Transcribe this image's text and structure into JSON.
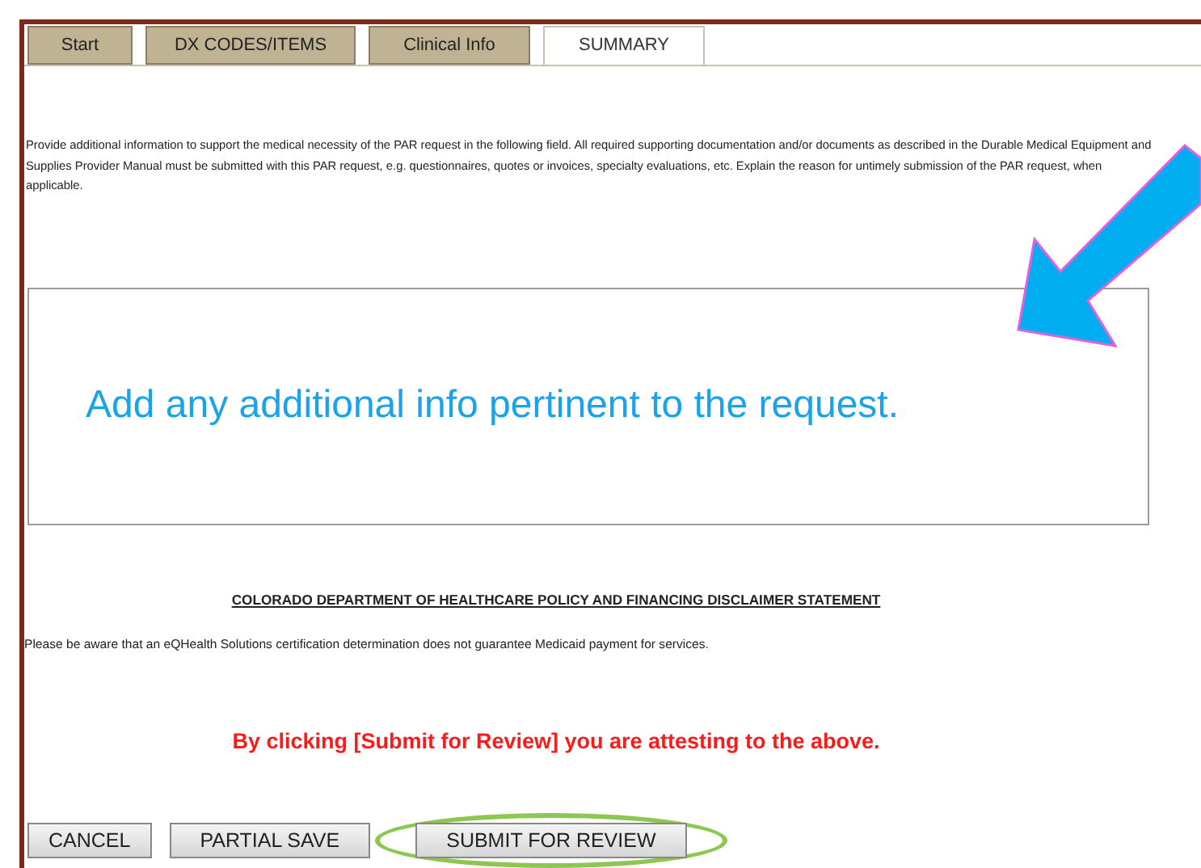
{
  "tabs": [
    {
      "label": "Start",
      "selected": false
    },
    {
      "label": "DX CODES/ITEMS",
      "selected": false
    },
    {
      "label": "Clinical Info",
      "selected": false
    },
    {
      "label": "SUMMARY",
      "selected": true
    }
  ],
  "instructions": "Provide additional information to support the medical necessity of the PAR request in the following field. All required supporting documentation and/or documents as described in the Durable Medical Equipment and Supplies Provider Manual must be submitted with this PAR request, e.g. questionnaires, quotes or invoices, specialty evaluations, etc. Explain the reason for untimely submission of the PAR request, when applicable.",
  "additional_info_field": {
    "annotation": "Add any additional info pertinent to the request."
  },
  "disclaimer": {
    "heading": "COLORADO DEPARTMENT OF HEALTHCARE POLICY AND FINANCING DISCLAIMER STATEMENT",
    "text": "Please be aware that an eQHealth Solutions certification determination does not guarantee Medicaid payment for services."
  },
  "attestation": "By clicking [Submit for Review] you are attesting to the above.",
  "buttons": [
    {
      "label": "CANCEL",
      "highlighted": false
    },
    {
      "label": "PARTIAL SAVE",
      "highlighted": false
    },
    {
      "label": "SUBMIT FOR REVIEW",
      "highlighted": true
    }
  ]
}
